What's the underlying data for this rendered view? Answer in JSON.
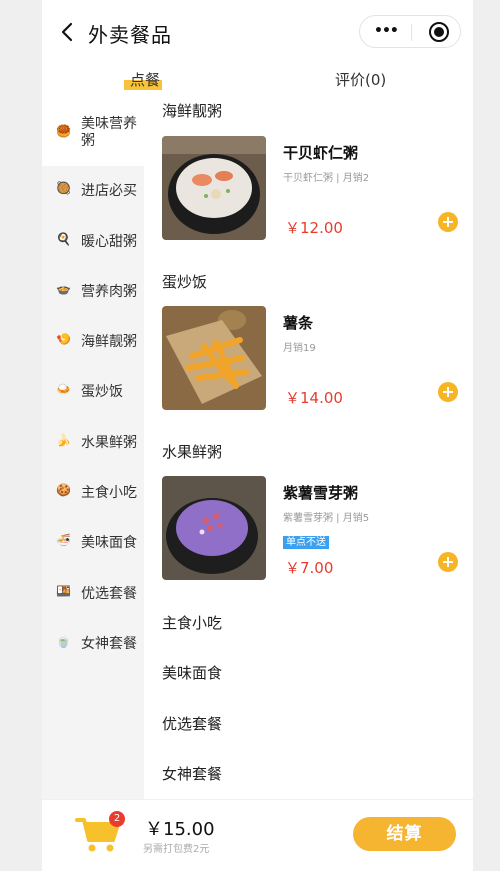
{
  "header": {
    "title": "外卖餐品",
    "back_icon": "chevron-left-icon",
    "more_icon": "more-dots-icon",
    "record_icon": "record-icon"
  },
  "tabs": [
    {
      "label": "点餐",
      "active": true
    },
    {
      "label": "评价(0)",
      "active": false
    }
  ],
  "sidebar": {
    "items": [
      {
        "label": "美味营养粥",
        "icon": "🥮",
        "active": true
      },
      {
        "label": "进店必买",
        "icon": "🥘"
      },
      {
        "label": "暖心甜粥",
        "icon": "🍳"
      },
      {
        "label": "营养肉粥",
        "icon": "🍲"
      },
      {
        "label": "海鲜靓粥",
        "icon": "🍤"
      },
      {
        "label": "蛋炒饭",
        "icon": "🍛"
      },
      {
        "label": "水果鲜粥",
        "icon": "🍌"
      },
      {
        "label": "主食小吃",
        "icon": "🍪"
      },
      {
        "label": "美味面食",
        "icon": "🍜"
      },
      {
        "label": "优选套餐",
        "icon": "🍱"
      },
      {
        "label": "女神套餐",
        "icon": "🍵"
      }
    ]
  },
  "menu": {
    "sections": [
      {
        "title": "海鲜靓粥",
        "dish": {
          "name": "干贝虾仁粥",
          "sub": "干贝虾仁粥 | 月销2",
          "price": "￥12.00"
        }
      },
      {
        "title": "蛋炒饭",
        "dish": {
          "name": "薯条",
          "sub": "月销19",
          "price": "￥14.00"
        }
      },
      {
        "title": "水果鲜粥",
        "dish": {
          "name": "紫薯雪芽粥",
          "sub": "紫薯雪芽粥 | 月销5",
          "badge": "单点不送",
          "price": "￥7.00"
        }
      },
      {
        "title": "主食小吃"
      },
      {
        "title": "美味面食"
      },
      {
        "title": "优选套餐"
      },
      {
        "title": "女神套餐"
      }
    ]
  },
  "cart": {
    "count": "2",
    "total": "￥15.00",
    "pack_fee": "另需打包费2元",
    "checkout_label": "结算",
    "icon": "cart-icon"
  },
  "colors": {
    "accent": "#f5b530",
    "price": "#e73c2e",
    "badge": "#3ba0ef"
  }
}
